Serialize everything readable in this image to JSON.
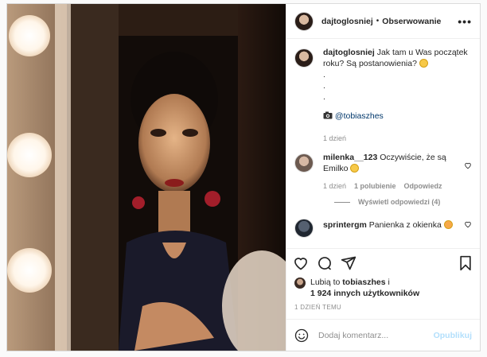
{
  "post": {
    "username": "dajtoglosniej",
    "separator": "•",
    "follow_label": "Obserwowanie",
    "more_label": "•••",
    "caption": {
      "username": "dajtoglosniej",
      "text": "Jak tam u Was początek roku? Są postanowienia?",
      "dots": [
        ".",
        ".",
        "."
      ],
      "camera_icon": "camera-icon",
      "mention": "@tobiaszhes",
      "time": "1 dzień"
    },
    "comments": [
      {
        "username": "milenka__123",
        "text": "Oczywiście, że są Emilko",
        "time": "1 dzień",
        "likes": "1 polubienie",
        "reply_label": "Odpowiedz"
      },
      {
        "username": "sprintergm",
        "text": "Panienka z okienka"
      }
    ],
    "view_replies": "Wyświetl odpowiedzi (4)",
    "likes": {
      "prefix": "Lubią to",
      "user": "tobiaszhes",
      "suffix": "i",
      "others": "1 924 innych użytkowników"
    },
    "date": "1 DZIEŃ TEMU",
    "add_comment": {
      "placeholder": "Dodaj komentarz...",
      "publish_label": "Opublikuj"
    }
  },
  "colors": {
    "accent": "#0095f6",
    "publish_disabled": "#b2dffc",
    "border": "#dbdbdb",
    "muted": "#8e8e8e"
  }
}
